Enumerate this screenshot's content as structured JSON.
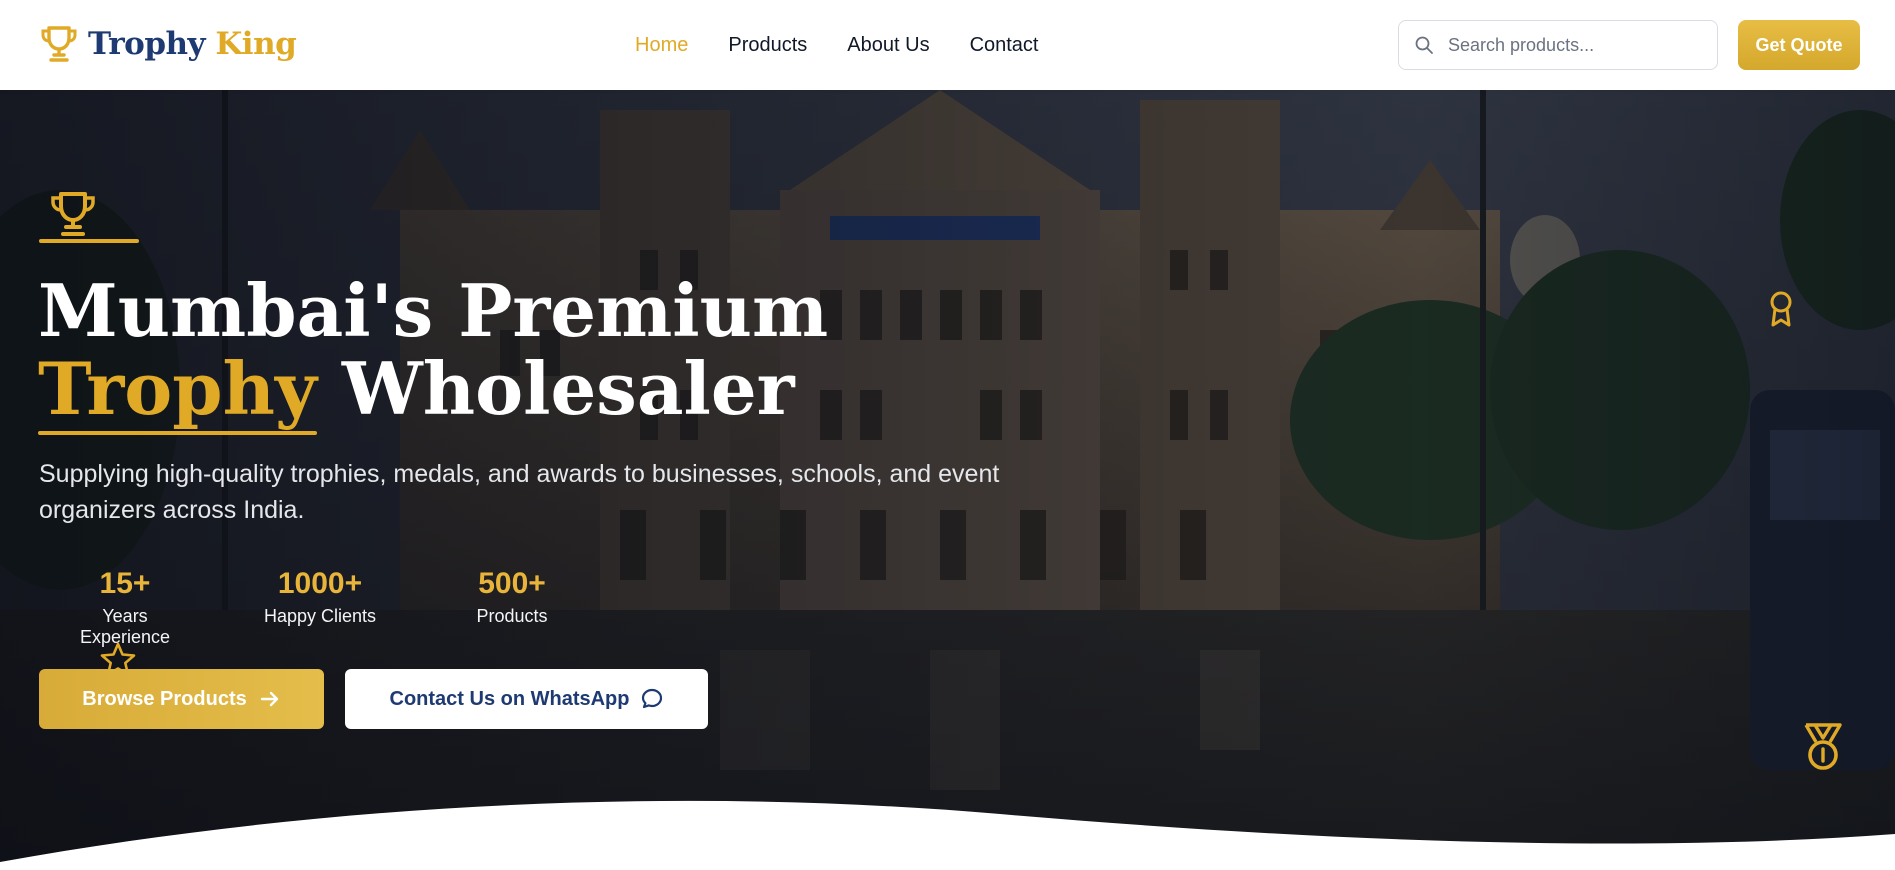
{
  "brand": {
    "name_primary": "Trophy",
    "name_accent": "King",
    "icon": "trophy-icon"
  },
  "nav": {
    "items": [
      {
        "label": "Home",
        "active": true
      },
      {
        "label": "Products",
        "active": false
      },
      {
        "label": "About Us",
        "active": false
      },
      {
        "label": "Contact",
        "active": false
      }
    ]
  },
  "search": {
    "placeholder": "Search products...",
    "value": ""
  },
  "header": {
    "quote_label": "Get Quote"
  },
  "hero": {
    "title_line1": "Mumbai's Premium",
    "title_accent": "Trophy",
    "title_line2_rest": " Wholesaler",
    "subtitle": "Supplying high-quality trophies, medals, and awards to businesses, schools, and event organizers across India.",
    "stats": [
      {
        "value": "15+",
        "label": "Years Experience"
      },
      {
        "value": "1000+",
        "label": "Happy Clients"
      },
      {
        "value": "500+",
        "label": "Products"
      }
    ],
    "browse_label": "Browse Products",
    "whatsapp_label": "Contact Us on WhatsApp"
  },
  "colors": {
    "gold": "#e0aa27",
    "navy": "#1e3a72",
    "white": "#ffffff"
  }
}
